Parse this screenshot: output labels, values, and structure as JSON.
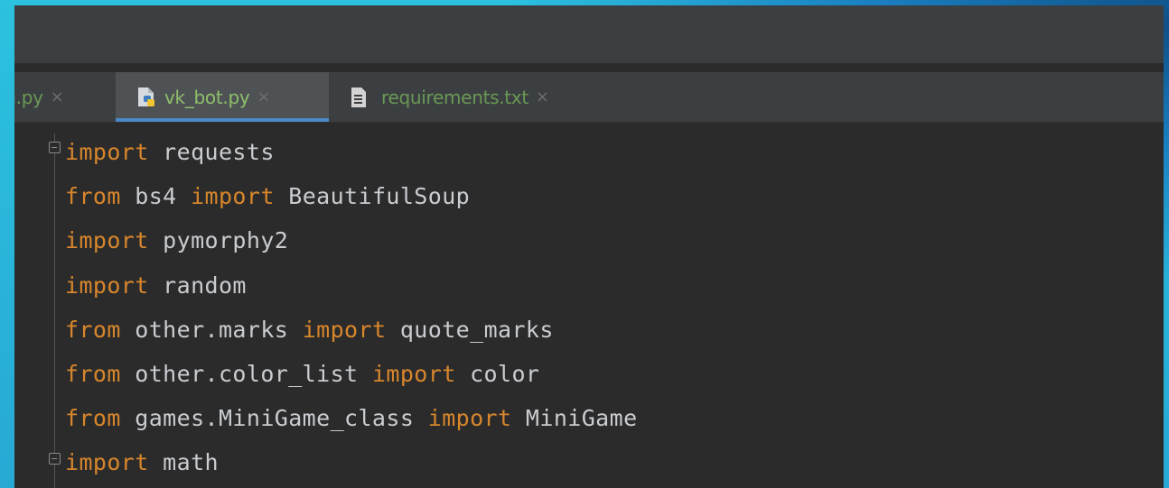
{
  "tabs": [
    {
      "label": "in.py",
      "close": "×",
      "icon": "python-file-icon"
    },
    {
      "label": "vk_bot.py",
      "close": "×",
      "icon": "python-file-icon",
      "active": true
    },
    {
      "label": "requirements.txt",
      "close": "×",
      "icon": "text-file-icon"
    }
  ],
  "code": {
    "lines": [
      {
        "kw": "import",
        "rest": " requests"
      },
      {
        "kw": "from",
        "mid": " bs4 ",
        "kw2": "import",
        "rest": " BeautifulSoup"
      },
      {
        "kw": "import",
        "rest": " pymorphy2"
      },
      {
        "kw": "import",
        "rest": " random"
      },
      {
        "kw": "from",
        "mid": " other.marks ",
        "kw2": "import",
        "rest": " quote_marks"
      },
      {
        "kw": "from",
        "mid": " other.color_list ",
        "kw2": "import",
        "rest": " color"
      },
      {
        "kw": "from",
        "mid": " games.MiniGame_class ",
        "kw2": "import",
        "rest": " MiniGame"
      },
      {
        "kw": "import",
        "rest": " math"
      }
    ]
  },
  "colors": {
    "keyword": "#d7862c",
    "identifier": "#c9ccd0",
    "editor_bg": "#2b2b2b",
    "tab_active_underline": "#4a88c7"
  }
}
